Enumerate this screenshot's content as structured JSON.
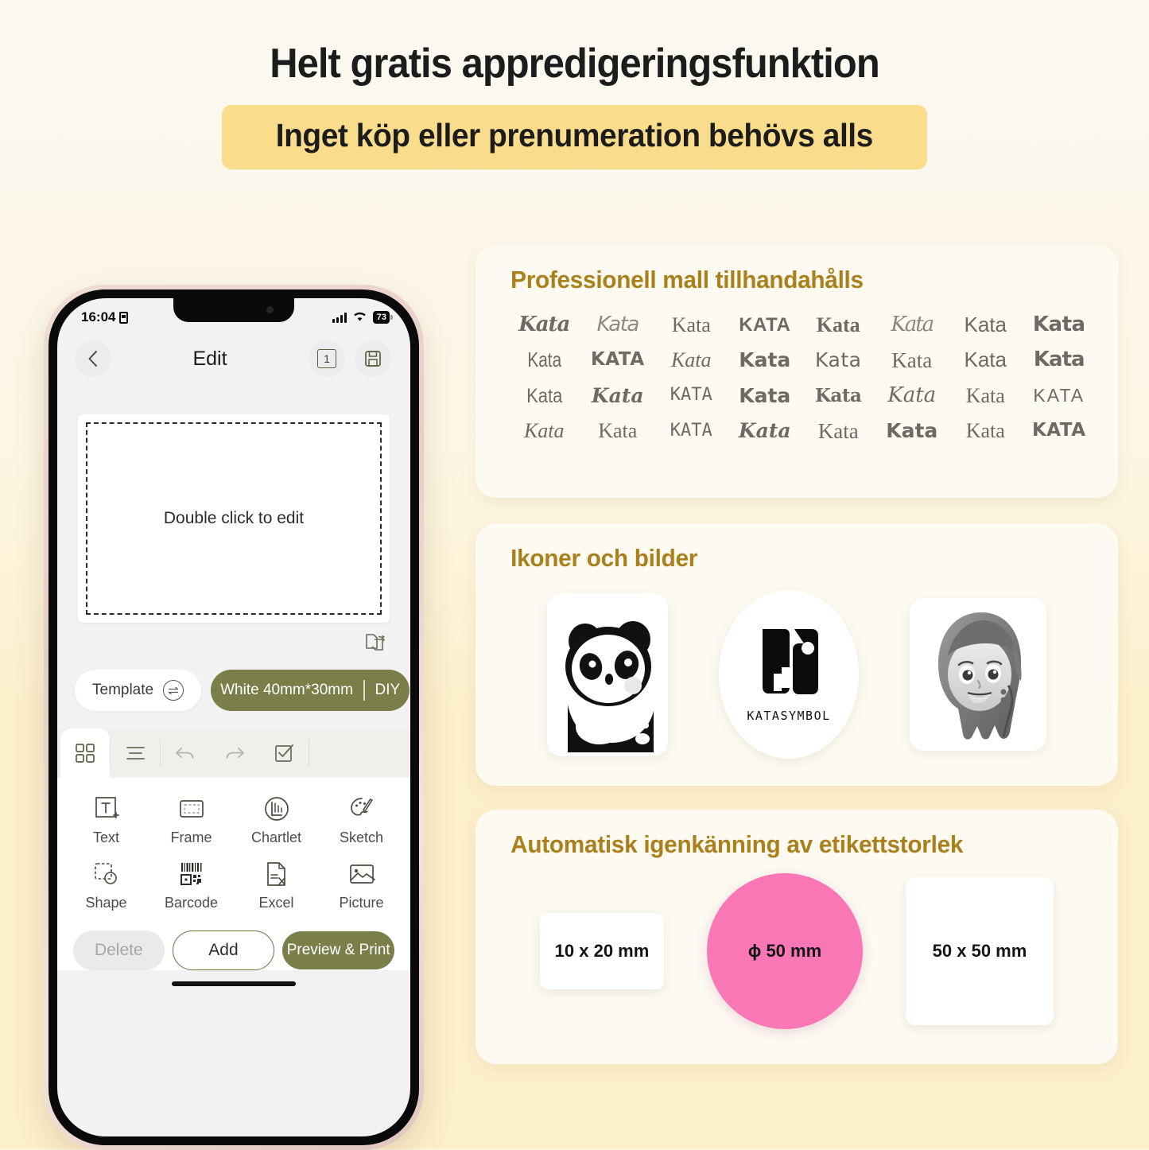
{
  "hero": {
    "title": "Helt gratis appredigeringsfunktion",
    "subtitle": "Inget köp eller prenumeration behövs alls",
    "band_color": "#FADD8C"
  },
  "phone": {
    "status_bar": {
      "time": "16:04",
      "sim_icon": "sim-card-icon",
      "signal_icon": "cellular-signal-icon",
      "wifi_icon": "wifi-icon",
      "battery_level": "73"
    },
    "nav": {
      "back_icon": "chevron-left-icon",
      "title": "Edit",
      "page_count": "1",
      "save_icon": "save-disk-icon"
    },
    "canvas": {
      "hint": "Double click to edit",
      "rotate_icon": "rotate-page-icon"
    },
    "template_row": {
      "template_label": "Template",
      "swap_icon": "swap-arrows-icon",
      "size_label": "White 40mm*30mm",
      "diy_label": "DIY"
    },
    "tabs": [
      {
        "name": "grid-tab",
        "icon": "grid-icon",
        "active": true
      },
      {
        "name": "align-tab",
        "icon": "align-lines-icon",
        "active": false
      },
      {
        "name": "undo-tab",
        "icon": "undo-arrow-icon",
        "active": false
      },
      {
        "name": "redo-tab",
        "icon": "redo-arrow-icon",
        "active": false
      },
      {
        "name": "select-tab",
        "icon": "checkbox-icon",
        "active": false
      }
    ],
    "tools": [
      {
        "label": "Text",
        "icon": "text-box-icon"
      },
      {
        "label": "Frame",
        "icon": "frame-icon"
      },
      {
        "label": "Chartlet",
        "icon": "chartlet-icon"
      },
      {
        "label": "Sketch",
        "icon": "palette-icon"
      },
      {
        "label": "Shape",
        "icon": "shape-icon"
      },
      {
        "label": "Barcode",
        "icon": "barcode-qr-icon"
      },
      {
        "label": "Excel",
        "icon": "excel-file-icon"
      },
      {
        "label": "Picture",
        "icon": "picture-icon"
      }
    ],
    "bottom_buttons": {
      "delete": "Delete",
      "add": "Add",
      "print": "Preview & Print"
    },
    "accent_olive": "#7A7F4A"
  },
  "cards": {
    "templates": {
      "title": "Professionell mall tillhandahålls",
      "samples": [
        "Kata",
        "Kata",
        "Kata",
        "KATA",
        "Kata",
        "Kata",
        "Kata",
        "Kata",
        "Kata",
        "KATA",
        "Kata",
        "Kata",
        "Kata",
        "Kata",
        "Kata",
        "Kata",
        "Kata",
        "Kata",
        "KATA",
        "Kata",
        "Kata",
        "Kata",
        "Kata",
        "KATA",
        "Kata",
        "Kata",
        "KATA",
        "Kata",
        "Kata",
        "Kata",
        "Kata",
        "KATA"
      ]
    },
    "icons": {
      "title": "Ikoner och bilder",
      "items": [
        {
          "name": "panda-sticker",
          "label": ""
        },
        {
          "name": "katasymbol-logo",
          "label": "KATASYMBOL"
        },
        {
          "name": "girl-portrait-sticker",
          "label": ""
        }
      ]
    },
    "sizes": {
      "title": "Automatisk igenkänning av etikettstorlek",
      "items": [
        {
          "name": "label-10x20",
          "label": "10 x 20 mm",
          "shape": "rect",
          "color": "#FFFFFF"
        },
        {
          "name": "label-circle-50",
          "label": "ɸ 50 mm",
          "shape": "circle",
          "color": "#F977B4"
        },
        {
          "name": "label-50x50",
          "label": "50 x 50 mm",
          "shape": "rect",
          "color": "#FFFFFF"
        }
      ]
    },
    "title_color": "#A9801B"
  }
}
